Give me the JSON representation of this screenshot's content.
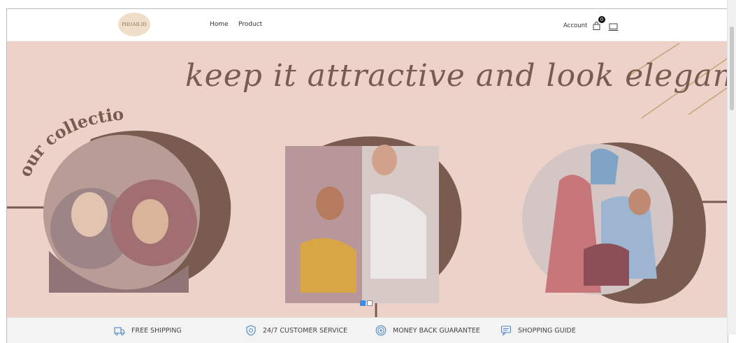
{
  "navbar": {
    "logo_text": "PHIJAB.ID",
    "links": [
      "Home",
      "Product"
    ],
    "account_label": "Account",
    "cart_count": "0",
    "cart_icon": "shopping-bag-icon",
    "device_icon": "laptop-icon"
  },
  "hero": {
    "tagline": "keep it attractive and look elegant",
    "collection_label": "our collection",
    "background_color": "#ecd2c9",
    "accent_color": "#7a5b50",
    "slides": {
      "total": 2,
      "active": 1
    },
    "images": [
      "two-women-in-hijabs-photo",
      "two-women-seated-photo",
      "three-women-in-hijabs-photo"
    ]
  },
  "features": [
    {
      "icon": "truck-icon",
      "label": "FREE SHIPPING"
    },
    {
      "icon": "shield-icon",
      "label": "24/7 CUSTOMER SERVICE"
    },
    {
      "icon": "coin-icon",
      "label": "MONEY BACK GUARANTEE"
    },
    {
      "icon": "chat-icon",
      "label": "SHOPPING GUIDE"
    }
  ]
}
